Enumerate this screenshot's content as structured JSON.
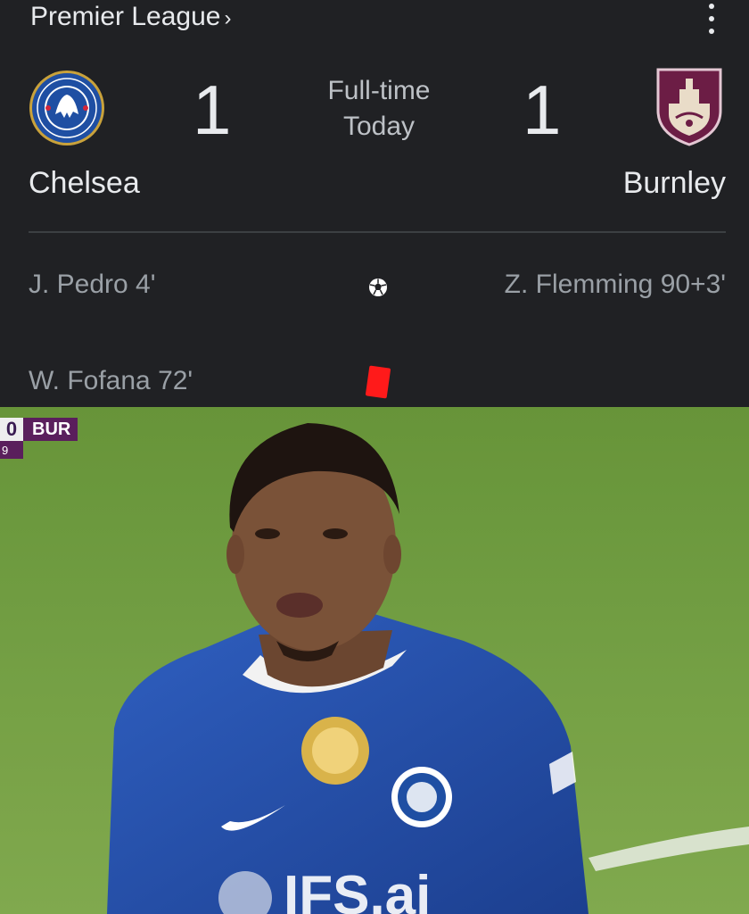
{
  "header": {
    "league": "Premier League",
    "chevron": "›"
  },
  "match": {
    "home_team": "Chelsea",
    "away_team": "Burnley",
    "home_score": "1",
    "away_score": "1",
    "status_line1": "Full-time",
    "status_line2": "Today"
  },
  "events": [
    {
      "team": "home",
      "text": "J. Pedro 4'",
      "icon": "soccer-ball-icon"
    },
    {
      "team": "away",
      "text": "Z. Flemming 90+3'",
      "icon": "soccer-ball-icon"
    },
    {
      "team": "home",
      "text": "W. Fofana 72'",
      "icon": "red-card-icon"
    }
  ],
  "broadcast": {
    "score": "0",
    "team": "BUR",
    "time": "9"
  },
  "colors": {
    "card_bg": "#202124",
    "text_primary": "#e8eaed",
    "text_secondary": "#9aa0a6",
    "red_card": "#ff1a1a",
    "pitch": "#6e9a38",
    "chelsea_blue": "#1f4fa3",
    "burnley_claret": "#6c1d45"
  }
}
